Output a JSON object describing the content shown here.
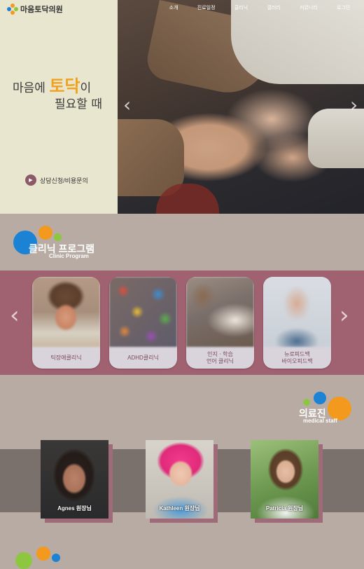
{
  "brand": {
    "name": "마음토닥의원",
    "logo_icon": "cross-dots-logo"
  },
  "nav": {
    "items": [
      "소개",
      "진료일정",
      "클리닉",
      "갤러리",
      "커뮤니티",
      "로그인"
    ]
  },
  "hero": {
    "tagline_prefix": "마음에 ",
    "tagline_accent": "토닥",
    "tagline_suffix": "이",
    "tagline_line2": "필요할 때",
    "consult_label": "상담신청/비용문의",
    "accent_color": "#f0a21f"
  },
  "programs": {
    "title_ko": "클리닉 프로그램",
    "title_en": "Clinic Program",
    "cards": [
      {
        "label_1": "틱장애클리닉",
        "label_2": ""
      },
      {
        "label_1": "ADHD클리닉",
        "label_2": ""
      },
      {
        "label_1": "인지ㆍ학습",
        "label_2": "언어 클리닉"
      },
      {
        "label_1": "뉴로피드백",
        "label_2": "바이오피드백"
      }
    ]
  },
  "staff": {
    "title_ko": "의료진",
    "title_en": "medical staff",
    "members": [
      {
        "name": "Agnes 원장님"
      },
      {
        "name": "Kathleen 원장님"
      },
      {
        "name": "Patricia 원장님"
      }
    ]
  },
  "colors": {
    "blue": "#1b82d4",
    "orange": "#f39a1e",
    "green": "#8dc63f",
    "band": "#a06170"
  }
}
